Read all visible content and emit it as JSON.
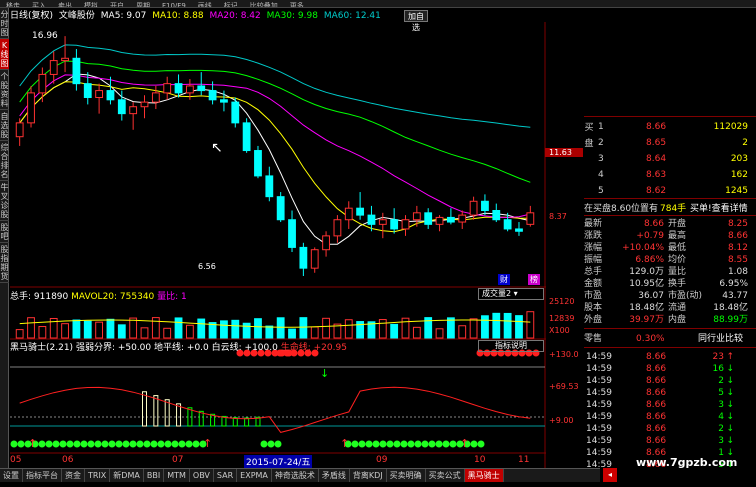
{
  "menu": {
    "items": [
      "移走",
      "买入",
      "卖出",
      "模拟",
      "开户",
      "周期",
      "F10/F9",
      "画线",
      "标记",
      "比较叠加",
      "更多"
    ]
  },
  "left_tabs": [
    {
      "label": "分时图",
      "active": false
    },
    {
      "label": "K线图",
      "active": true
    },
    {
      "label": "个股资料",
      "active": false
    },
    {
      "label": "自选股",
      "active": false
    },
    {
      "label": "综合排名",
      "active": false
    },
    {
      "label": "牛叉诊股",
      "active": false
    },
    {
      "label": "股吧",
      "active": false
    },
    {
      "label": "股指期货",
      "active": false
    }
  ],
  "header": {
    "period": "日线(复权)",
    "stock": "文峰股份",
    "ma5": "MA5: 9.07",
    "ma10": "MA10: 8.88",
    "ma20": "MA20: 8.42",
    "ma30": "MA30: 9.98",
    "ma60": "MA60: 12.41",
    "plus_btn": "加自选"
  },
  "colors": {
    "ma5": "#ffffff",
    "ma10": "#ffff00",
    "ma20": "#ff00ff",
    "ma30": "#00ff00",
    "ma60": "#00c8c8",
    "up": "#ff3232",
    "down": "#00ffff",
    "panel_bg": "#000000"
  },
  "price_chart": {
    "high_label": "16.96",
    "low_label": "6.56",
    "axis_labels": [
      "11.63",
      "8.37"
    ],
    "cursor_label": "11.63",
    "markers": [
      "财",
      "榜"
    ],
    "candles": [
      [
        12.6,
        13.4,
        12.2,
        13.2
      ],
      [
        13.2,
        14.8,
        13.0,
        14.5
      ],
      [
        14.5,
        15.6,
        14.1,
        15.3
      ],
      [
        15.3,
        16.3,
        14.9,
        15.9
      ],
      [
        15.9,
        16.96,
        15.4,
        16.0
      ],
      [
        16.0,
        16.4,
        14.6,
        14.9
      ],
      [
        14.9,
        15.4,
        14.0,
        14.3
      ],
      [
        14.3,
        14.9,
        13.6,
        14.6
      ],
      [
        14.6,
        15.2,
        14.0,
        14.2
      ],
      [
        14.2,
        14.6,
        13.3,
        13.6
      ],
      [
        13.6,
        14.1,
        12.9,
        13.9
      ],
      [
        13.9,
        14.4,
        13.4,
        14.1
      ],
      [
        14.1,
        14.8,
        13.8,
        14.5
      ],
      [
        14.5,
        15.2,
        14.2,
        14.9
      ],
      [
        14.9,
        15.3,
        14.3,
        14.5
      ],
      [
        14.5,
        15.1,
        14.2,
        14.8
      ],
      [
        14.8,
        15.4,
        14.4,
        14.6
      ],
      [
        14.6,
        15.0,
        14.0,
        14.2
      ],
      [
        14.2,
        14.6,
        13.7,
        14.1
      ],
      [
        14.1,
        14.3,
        13.0,
        13.2
      ],
      [
        13.2,
        13.4,
        11.9,
        12.0
      ],
      [
        12.0,
        12.2,
        10.8,
        10.9
      ],
      [
        10.9,
        11.3,
        9.8,
        10.0
      ],
      [
        10.0,
        10.2,
        8.9,
        9.0
      ],
      [
        9.0,
        9.4,
        7.6,
        7.8
      ],
      [
        7.8,
        8.0,
        6.56,
        6.9
      ],
      [
        6.9,
        7.8,
        6.7,
        7.7
      ],
      [
        7.7,
        8.5,
        7.4,
        8.3
      ],
      [
        8.3,
        9.2,
        8.0,
        9.0
      ],
      [
        9.0,
        9.8,
        8.6,
        9.5
      ],
      [
        9.5,
        10.2,
        9.0,
        9.2
      ],
      [
        9.2,
        9.6,
        8.5,
        8.8
      ],
      [
        8.8,
        9.3,
        8.2,
        9.0
      ],
      [
        9.0,
        9.5,
        8.4,
        8.6
      ],
      [
        8.6,
        9.2,
        8.3,
        9.0
      ],
      [
        9.0,
        9.6,
        8.7,
        9.3
      ],
      [
        9.3,
        9.5,
        8.6,
        8.8
      ],
      [
        8.8,
        9.2,
        8.5,
        9.1
      ],
      [
        9.1,
        9.5,
        8.8,
        8.9
      ],
      [
        8.9,
        9.4,
        8.6,
        9.2
      ],
      [
        9.2,
        10.0,
        9.0,
        9.8
      ],
      [
        9.8,
        10.1,
        9.2,
        9.4
      ],
      [
        9.4,
        9.7,
        8.9,
        9.0
      ],
      [
        9.0,
        9.3,
        8.5,
        8.6
      ],
      [
        8.6,
        8.9,
        8.3,
        8.5
      ],
      [
        8.8,
        9.6,
        8.7,
        9.3
      ]
    ],
    "ymin": 6.3,
    "ymax": 17.4
  },
  "volume_chart": {
    "label": "总手: 911890",
    "mavol": "MAVOL20: 755340",
    "ratio": "量比: 1",
    "dropdown": "成交量2",
    "axis_labels": [
      "25120",
      "12839",
      "X100"
    ]
  },
  "indicator": {
    "name": "黑马骑士(2.21)",
    "weak_line": "强弱分界: +50.00",
    "ground": "地平线: +0.0",
    "white": "白云线: +100.0",
    "life": "生命线: +20.95",
    "explain_btn": "指标说明",
    "axis_labels": [
      "+130.0",
      "+69.53",
      "+9.00"
    ]
  },
  "time_axis": [
    "05",
    "06",
    "07",
    "08",
    "09",
    "10",
    "11"
  ],
  "date_label": "2015-07-24/五",
  "order_book": {
    "sell": [
      {
        "n": "1",
        "p": "8.66",
        "v": "112029"
      },
      {
        "n": "2",
        "p": "8.65",
        "v": "2"
      },
      {
        "n": "3",
        "p": "8.64",
        "v": "203"
      },
      {
        "n": "4",
        "p": "8.63",
        "v": "162"
      },
      {
        "n": "5",
        "p": "8.62",
        "v": "1245"
      }
    ],
    "sell_label": "买盘",
    "note": "在买盘8.60位置有",
    "note_val": "784手",
    "note_btn": "买单!查看详情"
  },
  "quote": [
    {
      "a": "最新",
      "av": "8.66",
      "b": "开盘",
      "bv": "8.25"
    },
    {
      "a": "涨跌",
      "av": "+0.79",
      "b": "最高",
      "bv": "8.66"
    },
    {
      "a": "涨幅",
      "av": "+10.04%",
      "b": "最低",
      "bv": "8.12"
    },
    {
      "a": "振幅",
      "av": "6.86%",
      "b": "均价",
      "bv": "8.55"
    },
    {
      "a": "总手",
      "av": "129.0万",
      "b": "量比",
      "bv": "1.08"
    },
    {
      "a": "金额",
      "av": "10.95亿",
      "b": "换手",
      "bv": "6.95%"
    },
    {
      "a": "市盈",
      "av": "36.07",
      "b": "市盈(动)",
      "bv": "43.77"
    },
    {
      "a": "股本",
      "av": "18.48亿",
      "b": "流通",
      "bv": "18.48亿"
    },
    {
      "a": "外盘",
      "av": "39.97万",
      "b": "内盘",
      "bv": "88.99万"
    }
  ],
  "industry": {
    "retail": "零售",
    "pct": "0.30%",
    "compare": "同行业比较"
  },
  "ticks": [
    {
      "t": "14:59",
      "p": "8.66",
      "v": "23"
    },
    {
      "t": "14:59",
      "p": "8.66",
      "v": "16"
    },
    {
      "t": "14:59",
      "p": "8.66",
      "v": "2"
    },
    {
      "t": "14:59",
      "p": "8.66",
      "v": "5"
    },
    {
      "t": "14:59",
      "p": "8.66",
      "v": "3"
    },
    {
      "t": "14:59",
      "p": "8.66",
      "v": "4"
    },
    {
      "t": "14:59",
      "p": "8.66",
      "v": "2"
    },
    {
      "t": "14:59",
      "p": "8.66",
      "v": "3"
    },
    {
      "t": "14:59",
      "p": "8.66",
      "v": "1"
    },
    {
      "t": "14:59",
      "p": "8.66",
      "v": "5"
    }
  ],
  "bottom_tabs": [
    {
      "l": "设置",
      "a": false
    },
    {
      "l": "指标平台",
      "a": false
    },
    {
      "l": "资金",
      "a": false
    },
    {
      "l": "TRIX",
      "a": false
    },
    {
      "l": "新DMA",
      "a": false
    },
    {
      "l": "BBI",
      "a": false
    },
    {
      "l": "MTM",
      "a": false
    },
    {
      "l": "OBV",
      "a": false
    },
    {
      "l": "SAR",
      "a": false
    },
    {
      "l": "EXPMA",
      "a": false
    },
    {
      "l": "神奇选股术",
      "a": false
    },
    {
      "l": "矛盾线",
      "a": false
    },
    {
      "l": "背离KDJ",
      "a": false
    },
    {
      "l": "买卖明确",
      "a": false
    },
    {
      "l": "买卖公式",
      "a": false
    },
    {
      "l": "黑马骑士",
      "a": true
    }
  ],
  "watermark": "www.7gpzb.com"
}
